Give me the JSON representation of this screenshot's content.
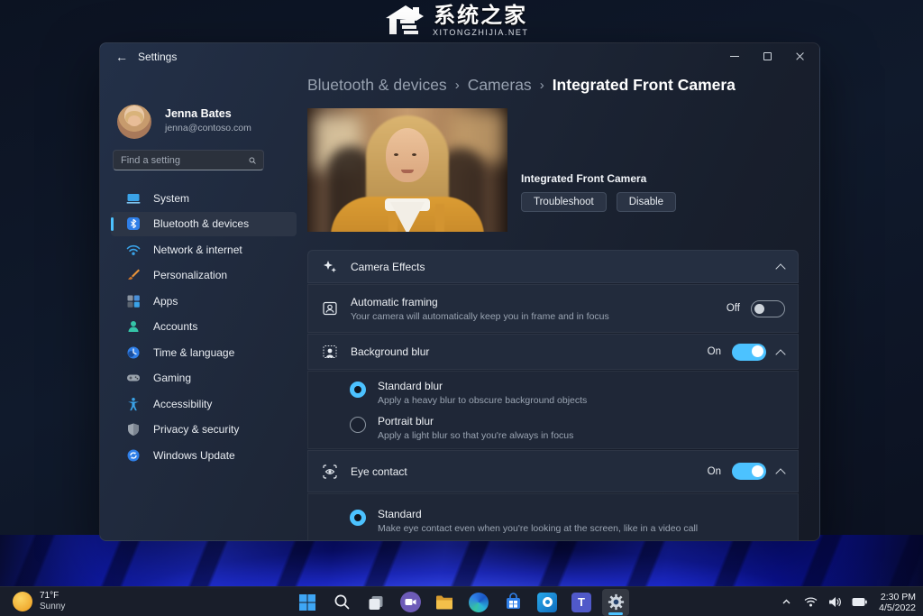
{
  "watermark": {
    "title": "系统之家",
    "subtitle": "XITONGZHIJIA.NET"
  },
  "window": {
    "title": "Settings"
  },
  "user": {
    "name": "Jenna Bates",
    "email": "jenna@contoso.com"
  },
  "search": {
    "placeholder": "Find a setting"
  },
  "sidebar": {
    "items": [
      {
        "label": "System",
        "icon": "system-icon",
        "selected": false
      },
      {
        "label": "Bluetooth & devices",
        "icon": "bluetooth-icon",
        "selected": true
      },
      {
        "label": "Network & internet",
        "icon": "network-icon",
        "selected": false
      },
      {
        "label": "Personalization",
        "icon": "personalization-icon",
        "selected": false
      },
      {
        "label": "Apps",
        "icon": "apps-icon",
        "selected": false
      },
      {
        "label": "Accounts",
        "icon": "accounts-icon",
        "selected": false
      },
      {
        "label": "Time & language",
        "icon": "time-language-icon",
        "selected": false
      },
      {
        "label": "Gaming",
        "icon": "gaming-icon",
        "selected": false
      },
      {
        "label": "Accessibility",
        "icon": "accessibility-icon",
        "selected": false
      },
      {
        "label": "Privacy & security",
        "icon": "privacy-security-icon",
        "selected": false
      },
      {
        "label": "Windows Update",
        "icon": "windows-update-icon",
        "selected": false
      }
    ]
  },
  "breadcrumb": {
    "items": [
      "Bluetooth & devices",
      "Cameras",
      "Integrated Front Camera"
    ],
    "separator": "›"
  },
  "device": {
    "name": "Integrated Front Camera",
    "troubleshoot_label": "Troubleshoot",
    "disable_label": "Disable"
  },
  "effects": {
    "header_title": "Camera Effects",
    "automatic_framing": {
      "title": "Automatic framing",
      "subtitle": "Your camera will automatically keep you in frame and in focus",
      "state": "Off"
    },
    "background_blur": {
      "title": "Background blur",
      "state": "On",
      "options": [
        {
          "title": "Standard blur",
          "desc": "Apply a heavy blur to obscure background objects",
          "selected": true
        },
        {
          "title": "Portrait blur",
          "desc": "Apply a light blur so that you're always in focus",
          "selected": false
        }
      ]
    },
    "eye_contact": {
      "title": "Eye contact",
      "state": "On",
      "options": [
        {
          "title": "Standard",
          "desc": "Make eye contact even when you're looking at the screen, like in a video call",
          "selected": true
        }
      ]
    }
  },
  "taskbar": {
    "icons": [
      "start-icon",
      "search-icon",
      "task-view-icon",
      "camera-app-icon",
      "file-explorer-icon",
      "edge-icon",
      "store-icon",
      "outlook-icon",
      "teams-icon",
      "settings-icon"
    ],
    "teams_letter": "T"
  },
  "weather": {
    "temperature": "71°F",
    "condition": "Sunny"
  },
  "tray": {
    "time": "2:30 PM",
    "date": "4/5/2022"
  },
  "colors": {
    "accent": "#4cc2ff",
    "window_bg": "#1e2738",
    "card_bg": "#222b3c",
    "bloom_blue": "#2436f0"
  }
}
